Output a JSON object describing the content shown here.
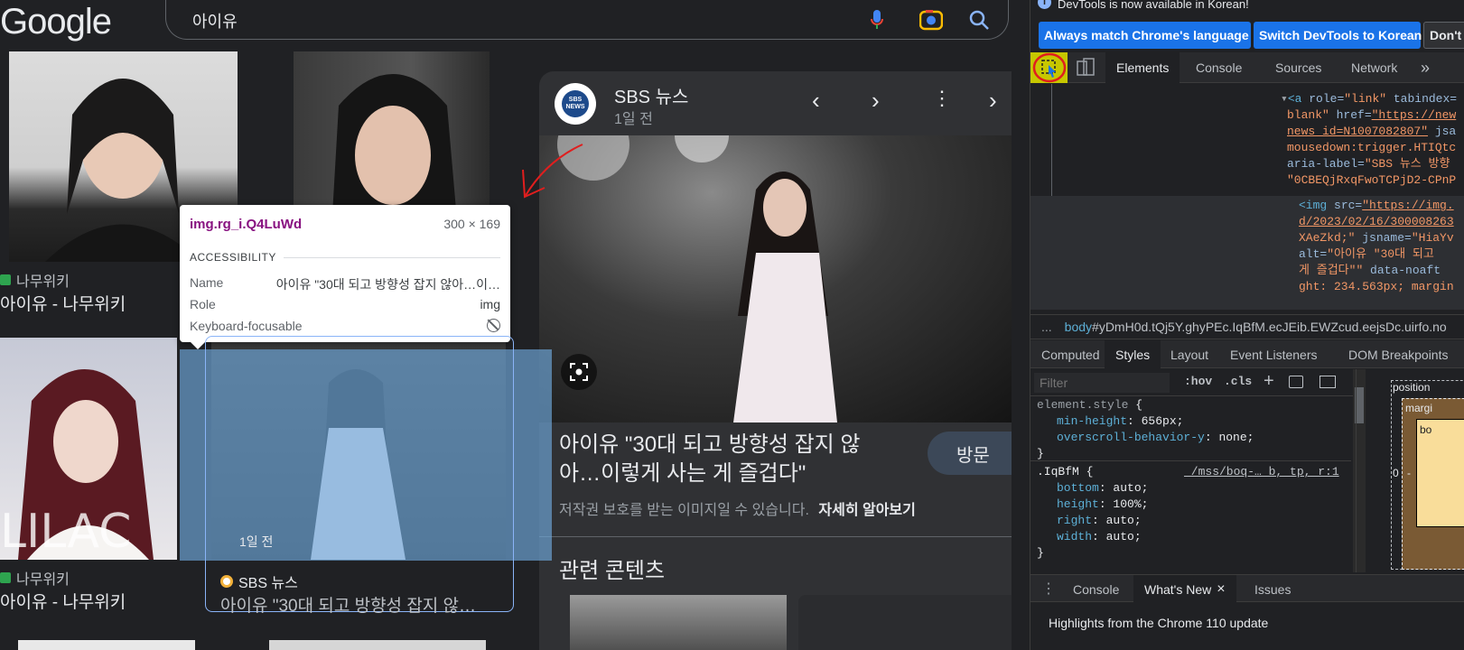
{
  "google": {
    "logo": "Google",
    "search_query": "아이유",
    "results": [
      {
        "source": "나무위키",
        "title": "아이유 - 나무위키"
      },
      {
        "source": "나무위키",
        "title": "아이유 - 나무위키"
      }
    ],
    "card_time": "1일 전",
    "card_source": "SBS 뉴스",
    "card_title": "아이유 \"30대 되고 방향성 잡지 않…"
  },
  "panel": {
    "source_name": "SBS 뉴스",
    "source_logo": "SBS NEWS",
    "time": "1일 전",
    "headline_line1": "아이유 \"30대 되고 방향성 잡지 않",
    "headline_line2": "아…이렇게 사는 게 즐겁다\"",
    "visit_button": "방문",
    "copyright": "저작권 보호를 받는 이미지일 수 있습니다.",
    "learn_more": "자세히 알아보기",
    "related": "관련 콘텐츠"
  },
  "tooltip": {
    "element": "img.rg_i.Q4LuWd",
    "size": "300 × 169",
    "section": "ACCESSIBILITY",
    "name_label": "Name",
    "name_value": "아이유 \"30대 되고 방향성 잡지 않아…이…",
    "role_label": "Role",
    "role_value": "img",
    "focus_label": "Keyboard-focusable"
  },
  "devtools": {
    "info": "DevTools is now available in Korean!",
    "btn_match": "Always match Chrome's language",
    "btn_switch": "Switch DevTools to Korean",
    "btn_dont": "Don't",
    "tabs": [
      "Elements",
      "Console",
      "Sources",
      "Network"
    ],
    "more": "»",
    "code": {
      "l1a": "<a",
      "l1b": " role=",
      "l1c": "\"link\"",
      "l1d": " tabindex=",
      "l2a": "blank\"",
      "l2b": " href=",
      "l2c": "\"https://new",
      "l3": "news_id=N1007082807\"",
      "l3b": " jsa",
      "l4": "mousedown:trigger.HTIQtc",
      "l5a": "aria-label=",
      "l5b": "\"SBS 뉴스 방향",
      "l6": "\"0CBEQjRxqFwoTCPjD2-CPnP",
      "l7a": "<img",
      "l7b": " src=",
      "l7c": "\"https://img.",
      "l8": "d/2023/02/16/300008263",
      "l9a": "XAeZkd;\"",
      "l9b": " jsname=",
      "l9c": "\"HiaYv",
      "l10a": "alt=",
      "l10b": "\"아이유 \"30대 되고",
      "l11a": "게 즐겁다\"\"",
      "l11b": " data-noaft",
      "l12": "ght: 234.563px; margin"
    },
    "breadcrumb_dots": "...",
    "breadcrumb_body": "body",
    "breadcrumb_rest": "#yDmH0d.tQj5Y.ghyPEc.IqBfM.ecJEib.EWZcud.eejsDc.uirfo.no",
    "style_tabs": [
      "Computed",
      "Styles",
      "Layout",
      "Event Listeners",
      "DOM Breakpoints"
    ],
    "filter_placeholder": "Filter",
    "hov": ":hov",
    "cls": ".cls",
    "plus": "+",
    "css": {
      "sel1": "element.style",
      "p1": "min-height",
      "v1": "656px",
      "p2": "overscroll-behavior-y",
      "v2": "none",
      "sel2": ".IqBfM",
      "src2": "_/mss/boq-…_b,_tp,_r:1",
      "p3": "bottom",
      "v3": "auto",
      "p4": "height",
      "v4": "100%",
      "p5": "right",
      "v5": "auto",
      "p6": "width",
      "v6": "auto"
    },
    "box": {
      "position": "position",
      "margin": "margi",
      "border": "bo",
      "zero": "0",
      "dash": "-"
    },
    "drawer_tabs": [
      "Console",
      "What's New",
      "Issues"
    ],
    "close": "×",
    "whats_new": "Highlights from the Chrome 110 update"
  }
}
